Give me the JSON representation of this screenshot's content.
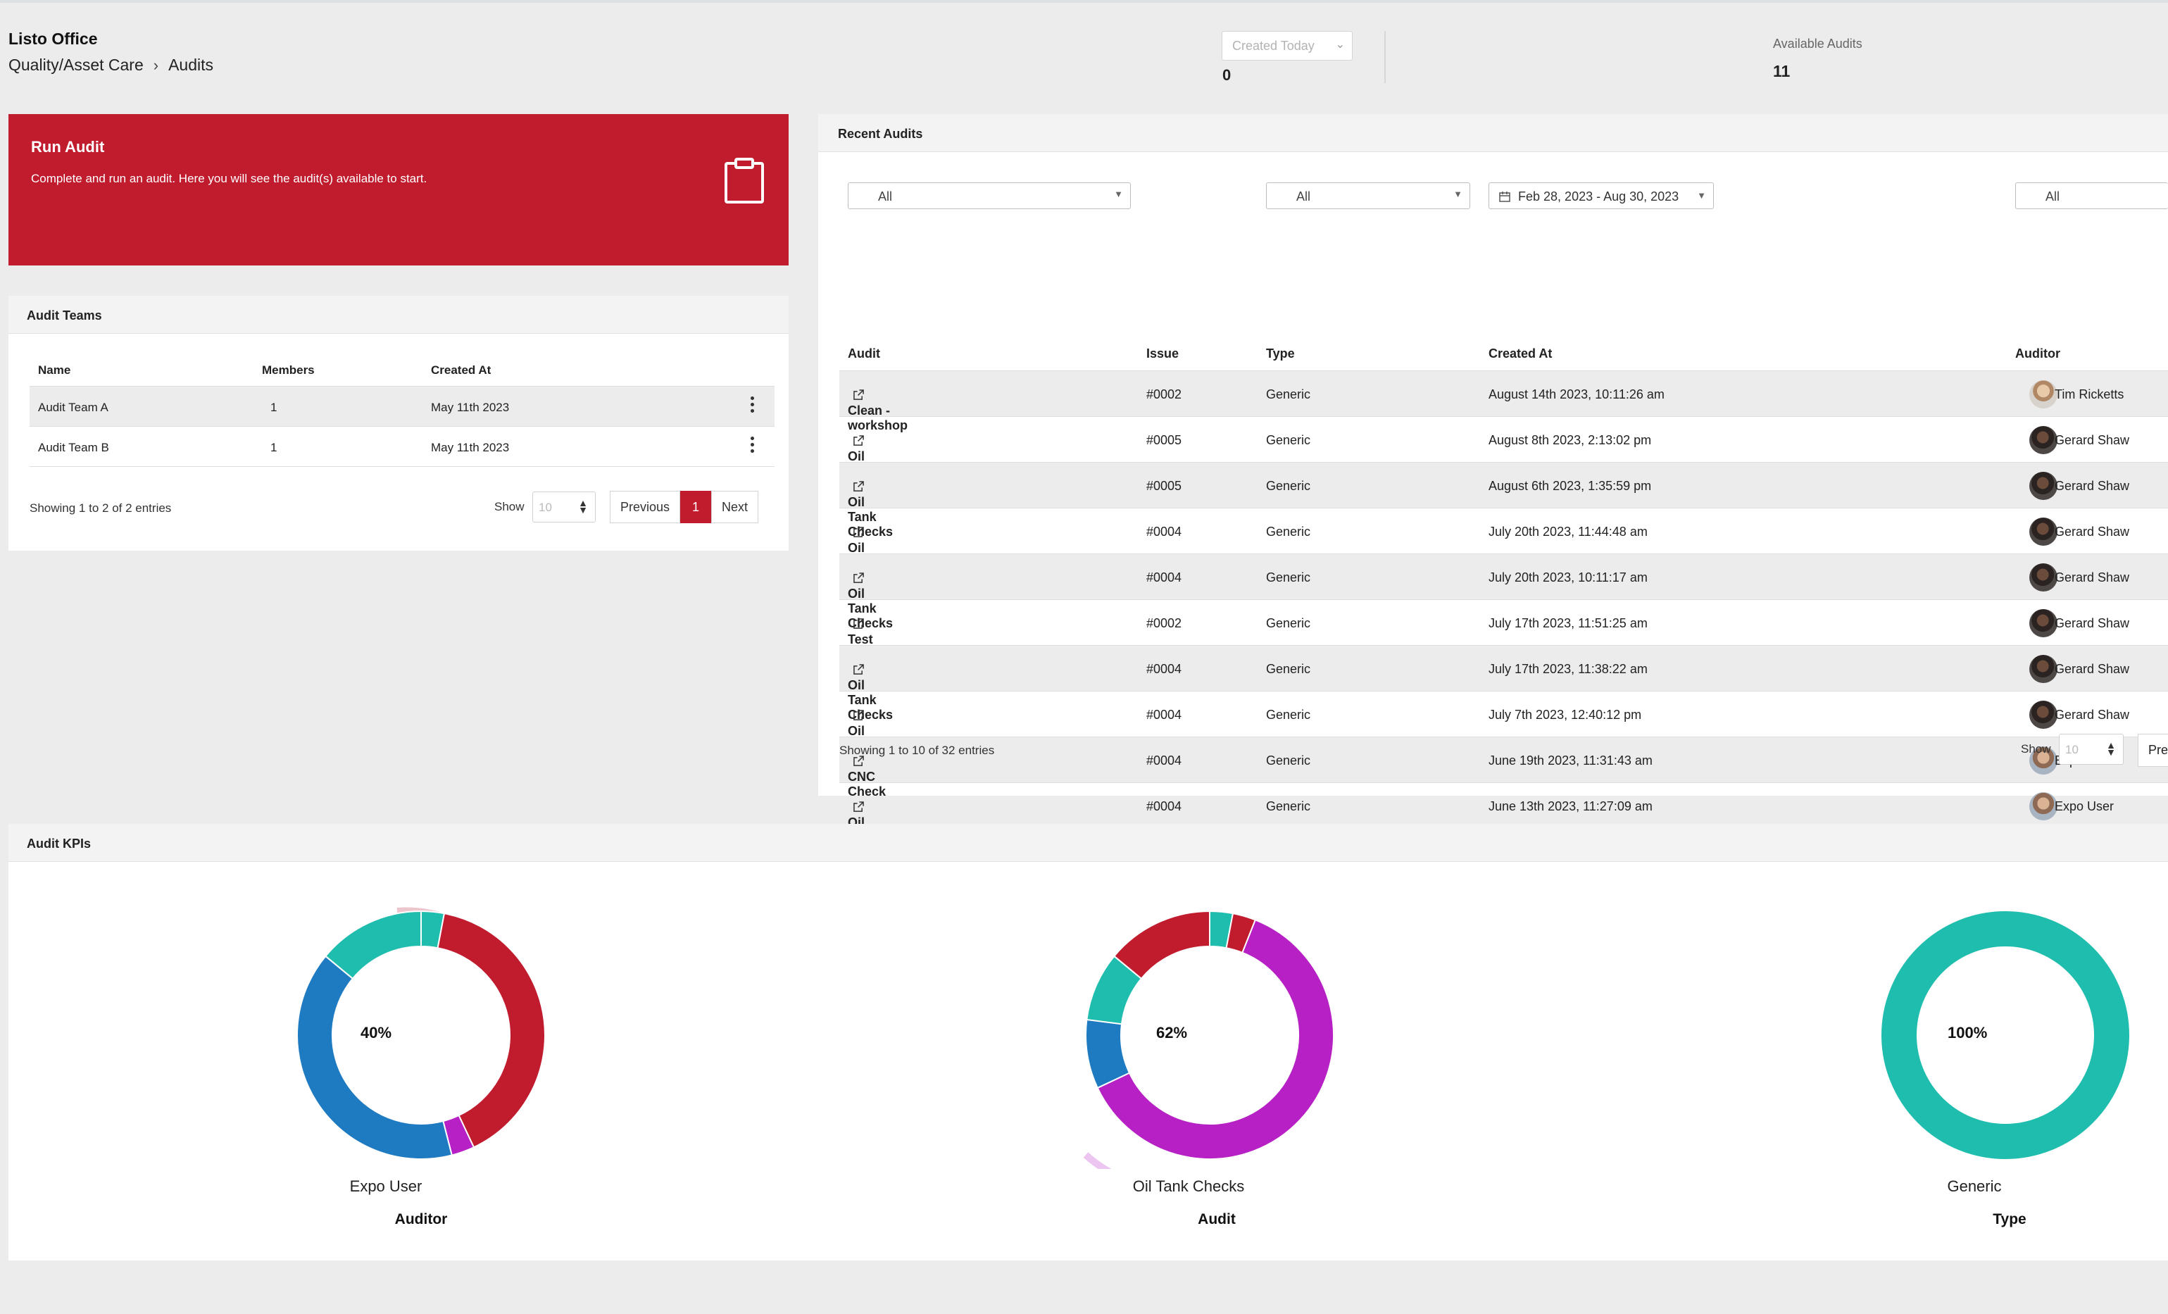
{
  "header": {
    "org": "Listo Office",
    "breadcrumb": [
      "Quality/Asset Care",
      "Audits"
    ],
    "created_filter": "Created Today",
    "created_count": "0",
    "available_label": "Available Audits",
    "available_count": "11"
  },
  "run_audit": {
    "title": "Run Audit",
    "description": "Complete and run an audit. Here you will see the audit(s) available to start.",
    "icon": "clipboard-icon"
  },
  "audit_teams": {
    "title": "Audit Teams",
    "columns": [
      "Name",
      "Members",
      "Created At"
    ],
    "rows": [
      {
        "name": "Audit Team A",
        "members": "1",
        "created": "May 11th 2023"
      },
      {
        "name": "Audit Team B",
        "members": "1",
        "created": "May 11th 2023"
      }
    ],
    "showing": "Showing 1 to 2 of 2 entries",
    "show_label": "Show",
    "page_size": "10",
    "prev": "Previous",
    "page": "1",
    "next": "Next"
  },
  "recent_audits": {
    "title": "Recent Audits",
    "filters": {
      "audit": "All",
      "type": "All",
      "date_range": "Feb 28, 2023 - Aug 30, 2023",
      "auditor": "All"
    },
    "columns": [
      "Audit",
      "Issue",
      "Type",
      "Created At",
      "Auditor"
    ],
    "rows": [
      {
        "audit": "Clean - workshop",
        "issue": "#0002",
        "type": "Generic",
        "created": "August 14th 2023, 10:11:26 am",
        "auditor": "Tim Ricketts",
        "avatar": "tim"
      },
      {
        "audit": "Oil Tank Checks",
        "issue": "#0005",
        "type": "Generic",
        "created": "August 8th 2023, 2:13:02 pm",
        "auditor": "Gerard Shaw",
        "avatar": "gerard"
      },
      {
        "audit": "Oil Tank Checks",
        "issue": "#0005",
        "type": "Generic",
        "created": "August 6th 2023, 1:35:59 pm",
        "auditor": "Gerard Shaw",
        "avatar": "gerard"
      },
      {
        "audit": "Oil Tank Checks",
        "issue": "#0004",
        "type": "Generic",
        "created": "July 20th 2023, 11:44:48 am",
        "auditor": "Gerard Shaw",
        "avatar": "gerard"
      },
      {
        "audit": "Oil Tank Checks",
        "issue": "#0004",
        "type": "Generic",
        "created": "July 20th 2023, 10:11:17 am",
        "auditor": "Gerard Shaw",
        "avatar": "gerard"
      },
      {
        "audit": "Test",
        "issue": "#0002",
        "type": "Generic",
        "created": "July 17th 2023, 11:51:25 am",
        "auditor": "Gerard Shaw",
        "avatar": "gerard"
      },
      {
        "audit": "Oil Tank Checks",
        "issue": "#0004",
        "type": "Generic",
        "created": "July 17th 2023, 11:38:22 am",
        "auditor": "Gerard Shaw",
        "avatar": "gerard"
      },
      {
        "audit": "Oil Tank Checks",
        "issue": "#0004",
        "type": "Generic",
        "created": "July 7th 2023, 12:40:12 pm",
        "auditor": "Gerard Shaw",
        "avatar": "gerard"
      },
      {
        "audit": "CNC Check",
        "issue": "#0004",
        "type": "Generic",
        "created": "June 19th 2023, 11:31:43 am",
        "auditor": "Expo User",
        "avatar": "expo"
      },
      {
        "audit": "Oil Tank Checks",
        "issue": "#0004",
        "type": "Generic",
        "created": "June 13th 2023, 11:27:09 am",
        "auditor": "Expo User",
        "avatar": "expo"
      }
    ],
    "showing": "Showing 1 to 10 of 32 entries",
    "show_label": "Show",
    "page_size": "10",
    "prev_partial": "Pre"
  },
  "kpis": {
    "title": "Audit KPIs",
    "colors": {
      "red": "#c11b2e",
      "teal": "#1fbdad",
      "blue": "#1e7bc2",
      "magenta": "#b620c4"
    },
    "charts": [
      {
        "center": "40%",
        "label": "Expo User",
        "title": "Auditor",
        "segments": [
          {
            "color": "#1fbdad",
            "frac": 0.03
          },
          {
            "color": "#c11b2e",
            "frac": 0.4
          },
          {
            "color": "#b620c4",
            "frac": 0.03
          },
          {
            "color": "#1e7bc2",
            "frac": 0.4
          },
          {
            "color": "#1fbdad",
            "frac": 0.14
          }
        ]
      },
      {
        "center": "62%",
        "label": "Oil Tank Checks",
        "title": "Audit",
        "segments": [
          {
            "color": "#1fbdad",
            "frac": 0.03
          },
          {
            "color": "#c11b2e",
            "frac": 0.03
          },
          {
            "color": "#b620c4",
            "frac": 0.62
          },
          {
            "color": "#1e7bc2",
            "frac": 0.09
          },
          {
            "color": "#1fbdad",
            "frac": 0.09
          },
          {
            "color": "#c11b2e",
            "frac": 0.14
          }
        ]
      },
      {
        "center": "100%",
        "label": "Generic",
        "title": "Type",
        "segments": [
          {
            "color": "#1fbdad",
            "frac": 1.0
          }
        ]
      }
    ]
  }
}
